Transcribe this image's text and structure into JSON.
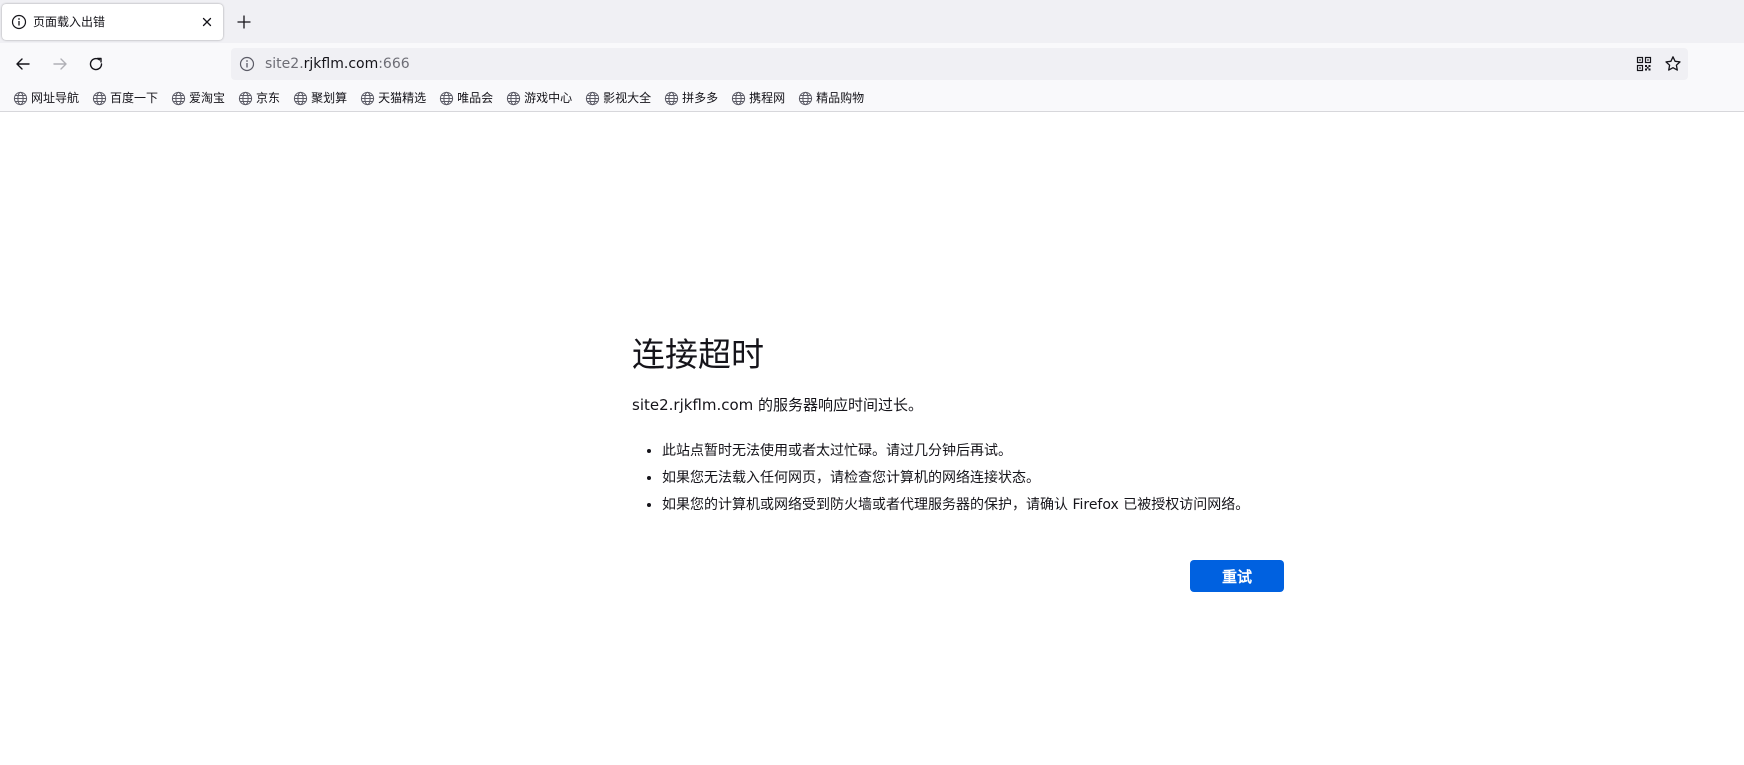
{
  "tab": {
    "title": "页面载入出错",
    "icon": "info-icon",
    "close_icon": "close-icon"
  },
  "new_tab_icon": "plus-icon",
  "nav": {
    "back_icon": "arrow-left-icon",
    "forward_icon": "arrow-right-icon",
    "reload_icon": "reload-icon"
  },
  "urlbar": {
    "prefix": "site2.",
    "domain": "rjkflm.com",
    "suffix": ":666",
    "icon": "info-icon",
    "qr_icon": "qr-code-icon",
    "bookmark_icon": "star-icon"
  },
  "bookmarks": [
    {
      "label": "网址导航",
      "icon": "globe-icon"
    },
    {
      "label": "百度一下",
      "icon": "globe-icon"
    },
    {
      "label": "爱淘宝",
      "icon": "globe-icon"
    },
    {
      "label": "京东",
      "icon": "globe-icon"
    },
    {
      "label": "聚划算",
      "icon": "globe-icon"
    },
    {
      "label": "天猫精选",
      "icon": "globe-icon"
    },
    {
      "label": "唯品会",
      "icon": "globe-icon"
    },
    {
      "label": "游戏中心",
      "icon": "globe-icon"
    },
    {
      "label": "影视大全",
      "icon": "globe-icon"
    },
    {
      "label": "拼多多",
      "icon": "globe-icon"
    },
    {
      "label": "携程网",
      "icon": "globe-icon"
    },
    {
      "label": "精品购物",
      "icon": "globe-icon"
    }
  ],
  "error": {
    "title": "连接超时",
    "description": "site2.rjkflm.com 的服务器响应时间过长。",
    "items": [
      "此站点暂时无法使用或者太过忙碌。请过几分钟后再试。",
      "如果您无法载入任何网页，请检查您计算机的网络连接状态。",
      "如果您的计算机或网络受到防火墙或者代理服务器的保护，请确认 Firefox 已被授权访问网络。"
    ],
    "retry_label": "重试"
  },
  "colors": {
    "accent": "#0061e0",
    "titlebar": "#f0f0f4",
    "toolbar": "#f9f9fb"
  }
}
